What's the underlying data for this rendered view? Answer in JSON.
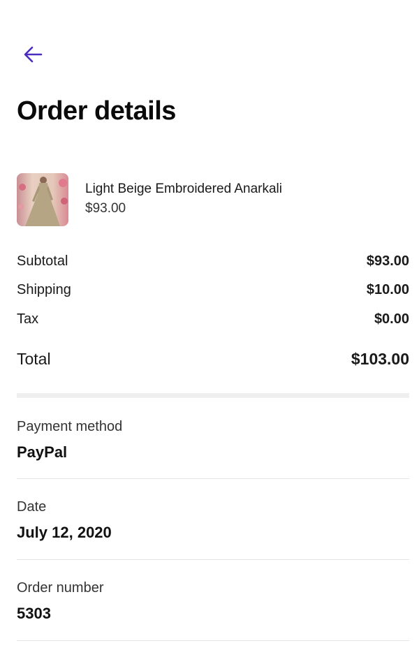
{
  "header": {
    "back_icon": "arrow-left-icon",
    "accent_color": "#4a2dbf",
    "title": "Order details"
  },
  "product": {
    "name": "Light Beige Embroidered Anarkali",
    "price": "$93.00"
  },
  "summary": {
    "subtotal_label": "Subtotal",
    "subtotal_value": "$93.00",
    "shipping_label": "Shipping",
    "shipping_value": "$10.00",
    "tax_label": "Tax",
    "tax_value": "$0.00",
    "total_label": "Total",
    "total_value": "$103.00"
  },
  "payment": {
    "label": "Payment method",
    "value": "PayPal"
  },
  "date": {
    "label": "Date",
    "value": "July 12, 2020"
  },
  "order": {
    "label": "Order number",
    "value": "5303"
  }
}
